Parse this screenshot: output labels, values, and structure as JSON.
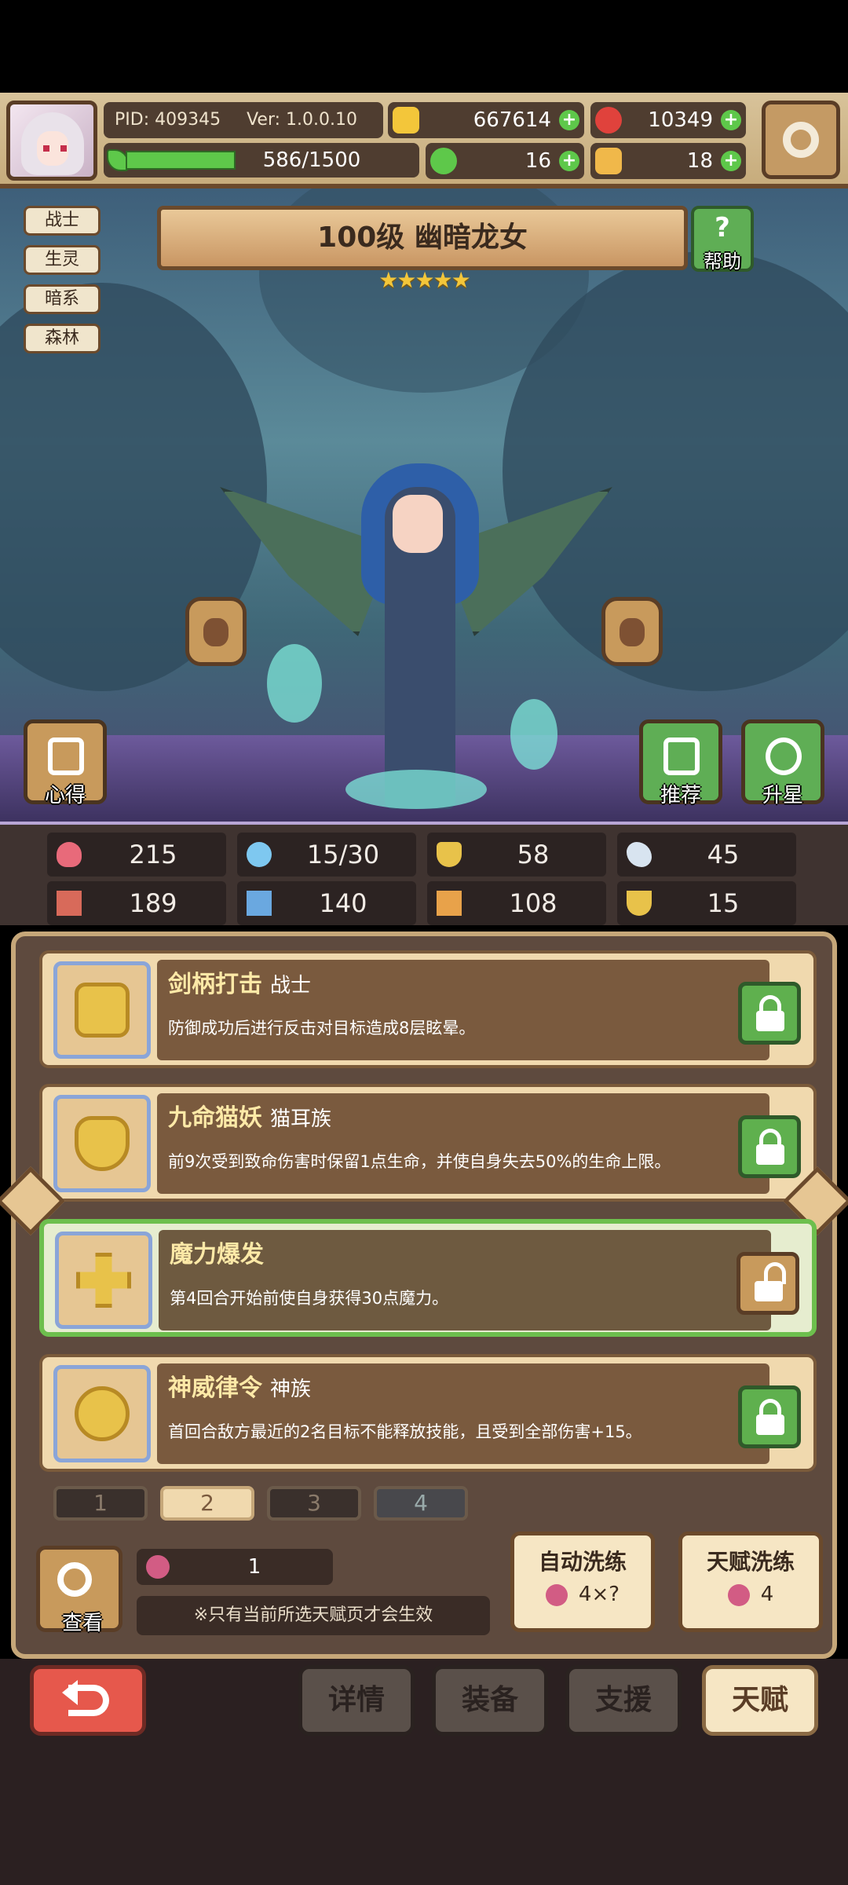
{
  "header": {
    "pid_label": "PID: 409345",
    "version": "Ver: 1.0.0.10",
    "xp_text": "586/1500",
    "xp_fraction": 0.39,
    "resources": [
      {
        "icon": "gold-coin-icon",
        "value": "667614",
        "color": "#f3c63a"
      },
      {
        "icon": "ruby-gem-icon",
        "value": "10349",
        "color": "#e0423c"
      },
      {
        "icon": "clover-icon",
        "value": "16",
        "color": "#5ec84a"
      },
      {
        "icon": "bread-icon",
        "value": "18",
        "color": "#f0b84a"
      }
    ]
  },
  "hero": {
    "tags": [
      "战士",
      "生灵",
      "暗系",
      "森林"
    ],
    "title": "100级 幽暗龙女",
    "stars": "★★★★★",
    "star_count": 5,
    "help_label": "帮助",
    "help_glyph": "?",
    "left_button_label": "心得",
    "recommend_label": "推荐",
    "upgrade_label": "升星"
  },
  "stats": [
    {
      "icon": "heart-icon",
      "value": "215",
      "color": "#e86a7a"
    },
    {
      "icon": "water-drop-icon",
      "value": "15/30",
      "color": "#7ec8f0"
    },
    {
      "icon": "shield-icon",
      "value": "58",
      "color": "#e8c24a"
    },
    {
      "icon": "wing-icon",
      "value": "45",
      "color": "#d8e4f0"
    },
    {
      "icon": "fist-icon",
      "value": "189",
      "color": "#d86a5a"
    },
    {
      "icon": "spellbook-icon",
      "value": "140",
      "color": "#6aa8e0"
    },
    {
      "icon": "boot-icon",
      "value": "108",
      "color": "#e8a24a"
    },
    {
      "icon": "horseshoe-icon",
      "value": "15",
      "color": "#e8c24a"
    }
  ],
  "talents": [
    {
      "name": "剑柄打击",
      "race": "战士",
      "desc": "防御成功后进行反击对目标造成8层眩晕。",
      "locked": true,
      "icon": "sword-shield-icon"
    },
    {
      "name": "九命猫妖",
      "race": "猫耳族",
      "desc": "前9次受到致命伤害时保留1点生命，并使自身失去50%的生命上限。",
      "locked": true,
      "icon": "cat-head-icon"
    },
    {
      "name": "魔力爆发",
      "race": "",
      "desc": "第4回合开始前使自身获得30点魔力。",
      "locked": false,
      "icon": "cross-burst-icon"
    },
    {
      "name": "神威律令",
      "race": "神族",
      "desc": "首回合敌方最近的2名目标不能释放技能，且受到全部伤害+15。",
      "locked": true,
      "icon": "divine-eye-icon"
    }
  ],
  "pages": [
    "1",
    "2",
    "3",
    "4"
  ],
  "selected_page": "2",
  "bottom": {
    "view_label": "查看",
    "fruit_count": "1",
    "note": "※只有当前所选天赋页才会生效",
    "auto_wash": {
      "label": "自动洗练",
      "cost": "4×?"
    },
    "talent_wash": {
      "label": "天赋洗练",
      "cost": "4"
    }
  },
  "nav": {
    "tabs": [
      "详情",
      "装备",
      "支援",
      "天赋"
    ],
    "selected": "天赋"
  }
}
